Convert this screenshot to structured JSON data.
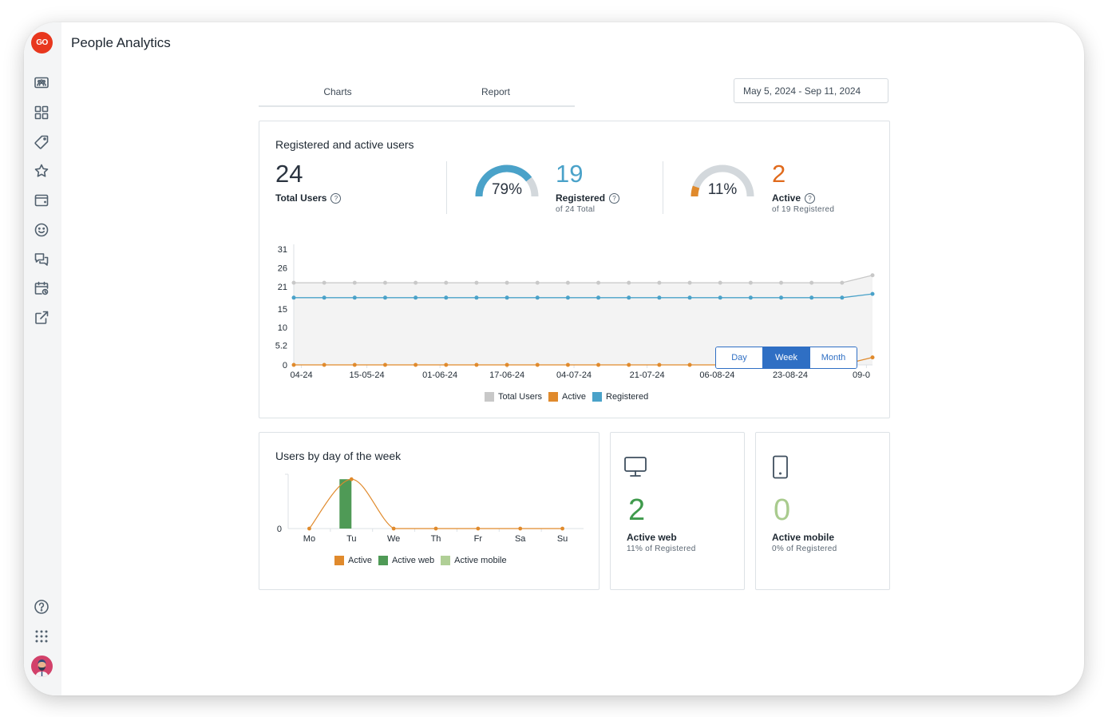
{
  "app": {
    "title": "People Analytics",
    "logo_text": "GO"
  },
  "sidebar": {
    "items": [
      {
        "name": "team-icon",
        "label": "Team"
      },
      {
        "name": "grid-icon",
        "label": "Dashboard"
      },
      {
        "name": "tag-icon",
        "label": "Tags"
      },
      {
        "name": "star-icon",
        "label": "Favorites"
      },
      {
        "name": "wallet-icon",
        "label": "Wallet"
      },
      {
        "name": "smiley-icon",
        "label": "Engagement"
      },
      {
        "name": "chat-icon",
        "label": "Messages"
      },
      {
        "name": "calendar-clock-icon",
        "label": "Schedule"
      },
      {
        "name": "external-link-icon",
        "label": "Open external"
      }
    ],
    "bottom": [
      {
        "name": "help-icon",
        "label": "Help"
      },
      {
        "name": "apps-grid-icon",
        "label": "Apps"
      },
      {
        "name": "avatar",
        "label": "User profile"
      }
    ]
  },
  "tabs": [
    {
      "label": "Charts",
      "active": true
    },
    {
      "label": "Report",
      "active": false
    }
  ],
  "date_range": "May 5, 2024 - Sep 11, 2024",
  "summary_card": {
    "title": "Registered and active users",
    "total": {
      "value": "24",
      "label": "Total Users"
    },
    "registered": {
      "value": "19",
      "label": "Registered",
      "sub": "of 24 Total",
      "percent": 79,
      "percent_text": "79%"
    },
    "active": {
      "value": "2",
      "label": "Active",
      "sub": "of 19 Registered",
      "percent": 11,
      "percent_text": "11%"
    },
    "granularity": {
      "options": [
        "Day",
        "Week",
        "Month"
      ],
      "selected": "Week"
    }
  },
  "colors": {
    "total": "#c8c8c8",
    "registered": "#4aa2c9",
    "active": "#e08a2c",
    "active_web": "#4f9a56",
    "active_mobile": "#b0cf96",
    "accent": "#2f6fc4"
  },
  "chart_data": [
    {
      "type": "line",
      "title": "",
      "xlabel": "",
      "ylabel": "",
      "y_ticks": [
        "0",
        "5.2",
        "10",
        "15",
        "21",
        "26",
        "31"
      ],
      "ylim": [
        0,
        31
      ],
      "x_tick_labels": [
        "04-24",
        "15-05-24",
        "01-06-24",
        "17-06-24",
        "04-07-24",
        "21-07-24",
        "06-08-24",
        "23-08-24",
        "09-0"
      ],
      "x_tick_indices": [
        0.25,
        2.4,
        4.8,
        7.0,
        9.2,
        11.6,
        13.9,
        16.3,
        18.8
      ],
      "point_count": 20,
      "series": [
        {
          "name": "Total Users",
          "values": [
            22,
            22,
            22,
            22,
            22,
            22,
            22,
            22,
            22,
            22,
            22,
            22,
            22,
            22,
            22,
            22,
            22,
            22,
            22,
            24
          ]
        },
        {
          "name": "Active",
          "values": [
            0,
            0,
            0,
            0,
            0,
            0,
            0,
            0,
            0,
            0,
            0,
            0,
            0,
            0,
            0,
            0,
            0,
            0,
            0,
            2
          ]
        },
        {
          "name": "Registered",
          "values": [
            18,
            18,
            18,
            18,
            18,
            18,
            18,
            18,
            18,
            18,
            18,
            18,
            18,
            18,
            18,
            18,
            18,
            18,
            18,
            19
          ]
        }
      ],
      "legend": [
        "Total Users",
        "Active",
        "Registered"
      ],
      "legend_position": "bottom",
      "grid": false
    },
    {
      "type": "bar",
      "title": "Users by day of the week",
      "categories": [
        "Mo",
        "Tu",
        "We",
        "Th",
        "Fr",
        "Sa",
        "Su"
      ],
      "y_ticks": [
        "0"
      ],
      "ylim": [
        0,
        2.2
      ],
      "series": [
        {
          "name": "Active",
          "type": "line",
          "values": [
            0,
            2,
            0,
            0,
            0,
            0,
            0
          ]
        },
        {
          "name": "Active web",
          "type": "bar",
          "values": [
            0,
            2,
            0,
            0,
            0,
            0,
            0
          ]
        },
        {
          "name": "Active mobile",
          "type": "bar",
          "values": [
            0,
            0,
            0,
            0,
            0,
            0,
            0
          ]
        }
      ],
      "legend": [
        "Active",
        "Active web",
        "Active mobile"
      ],
      "legend_position": "bottom"
    }
  ],
  "weekday_card": {
    "title": "Users by day of the week"
  },
  "web_card": {
    "value": "2",
    "label": "Active web",
    "sub": "11% of Registered"
  },
  "mobile_card": {
    "value": "0",
    "label": "Active mobile",
    "sub": "0% of Registered"
  }
}
